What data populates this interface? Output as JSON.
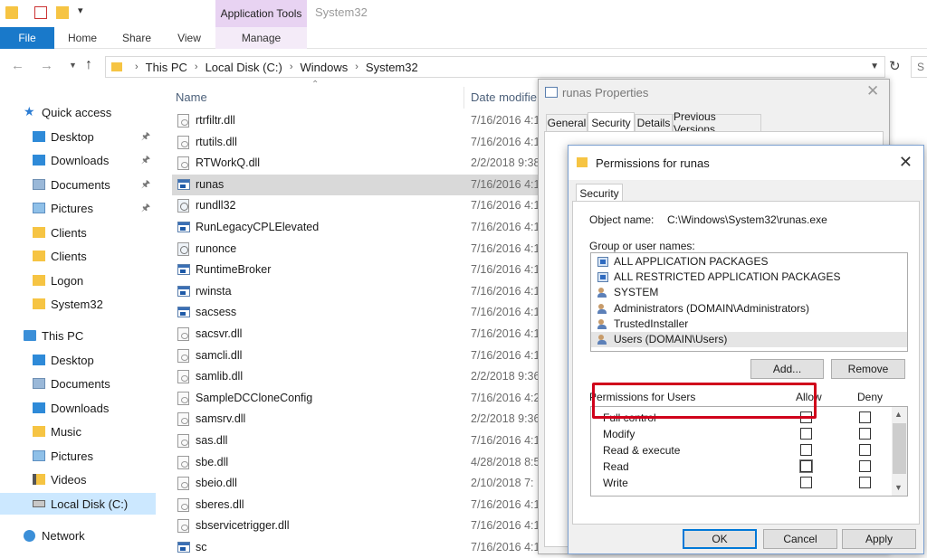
{
  "titlebar": {
    "context_tab": "Application Tools",
    "window_title": "System32"
  },
  "ribbon": {
    "tabs": [
      "File",
      "Home",
      "Share",
      "View",
      "Manage"
    ]
  },
  "address": {
    "crumbs": [
      "This PC",
      "Local Disk (C:)",
      "Windows",
      "System32"
    ],
    "search_placeholder": "S"
  },
  "nav": {
    "quick_access": "Quick access",
    "quick_items": [
      "Desktop",
      "Downloads",
      "Documents",
      "Pictures",
      "Clients",
      "Clients",
      "Logon",
      "System32"
    ],
    "this_pc": "This PC",
    "pc_items": [
      "Desktop",
      "Documents",
      "Downloads",
      "Music",
      "Pictures",
      "Videos",
      "Local Disk (C:)"
    ],
    "network": "Network"
  },
  "filelist": {
    "col_name": "Name",
    "col_date": "Date modifie",
    "files": [
      {
        "name": "rtrfiltr.dll",
        "date": "7/16/2016 4:1",
        "kind": "dll"
      },
      {
        "name": "rtutils.dll",
        "date": "7/16/2016 4:1",
        "kind": "dll"
      },
      {
        "name": "RTWorkQ.dll",
        "date": "2/2/2018 9:38",
        "kind": "dll"
      },
      {
        "name": "runas",
        "date": "7/16/2016 4:1",
        "kind": "exe"
      },
      {
        "name": "rundll32",
        "date": "7/16/2016 4:1",
        "kind": "cfg"
      },
      {
        "name": "RunLegacyCPLElevated",
        "date": "7/16/2016 4:1",
        "kind": "exe"
      },
      {
        "name": "runonce",
        "date": "7/16/2016 4:1",
        "kind": "cfg"
      },
      {
        "name": "RuntimeBroker",
        "date": "7/16/2016 4:1",
        "kind": "exe"
      },
      {
        "name": "rwinsta",
        "date": "7/16/2016 4:1",
        "kind": "exe"
      },
      {
        "name": "sacsess",
        "date": "7/16/2016 4:1",
        "kind": "exe"
      },
      {
        "name": "sacsvr.dll",
        "date": "7/16/2016 4:1",
        "kind": "dll"
      },
      {
        "name": "samcli.dll",
        "date": "7/16/2016 4:1",
        "kind": "dll"
      },
      {
        "name": "samlib.dll",
        "date": "2/2/2018 9:36",
        "kind": "dll"
      },
      {
        "name": "SampleDCCloneConfig",
        "date": "7/16/2016 4:2",
        "kind": "dll"
      },
      {
        "name": "samsrv.dll",
        "date": "2/2/2018 9:36",
        "kind": "dll"
      },
      {
        "name": "sas.dll",
        "date": "7/16/2016 4:1",
        "kind": "dll"
      },
      {
        "name": "sbe.dll",
        "date": "4/28/2018 8:5",
        "kind": "dll"
      },
      {
        "name": "sbeio.dll",
        "date": "2/10/2018 7:",
        "kind": "dll"
      },
      {
        "name": "sberes.dll",
        "date": "7/16/2016 4:1",
        "kind": "dll"
      },
      {
        "name": "sbservicetrigger.dll",
        "date": "7/16/2016 4:1",
        "kind": "dll"
      },
      {
        "name": "sc",
        "date": "7/16/2016 4:18 PM",
        "kind": "exe"
      }
    ]
  },
  "props": {
    "title": "runas Properties",
    "tabs": [
      "General",
      "Security",
      "Details",
      "Previous Versions"
    ]
  },
  "perm": {
    "title": "Permissions for runas",
    "tab": "Security",
    "object_label": "Object name:",
    "object_value": "C:\\Windows\\System32\\runas.exe",
    "groups_label": "Group or user names:",
    "groups": [
      {
        "name": "ALL APPLICATION PACKAGES",
        "icon": "package-icon"
      },
      {
        "name": "ALL RESTRICTED APPLICATION PACKAGES",
        "icon": "package-icon"
      },
      {
        "name": "SYSTEM",
        "icon": "users-icon"
      },
      {
        "name": "Administrators (DOMAIN\\Administrators)",
        "icon": "users-icon"
      },
      {
        "name": "TrustedInstaller",
        "icon": "users-icon"
      },
      {
        "name": "Users (DOMAIN\\Users)",
        "icon": "users-icon"
      }
    ],
    "add_button": "Add...",
    "remove_button": "Remove",
    "permissions_label": "Permissions for Users",
    "allow_label": "Allow",
    "deny_label": "Deny",
    "permissions": [
      "Full control",
      "Modify",
      "Read & execute",
      "Read",
      "Write"
    ],
    "ok": "OK",
    "cancel": "Cancel",
    "apply": "Apply",
    "highlight_color": "#d0021b"
  }
}
